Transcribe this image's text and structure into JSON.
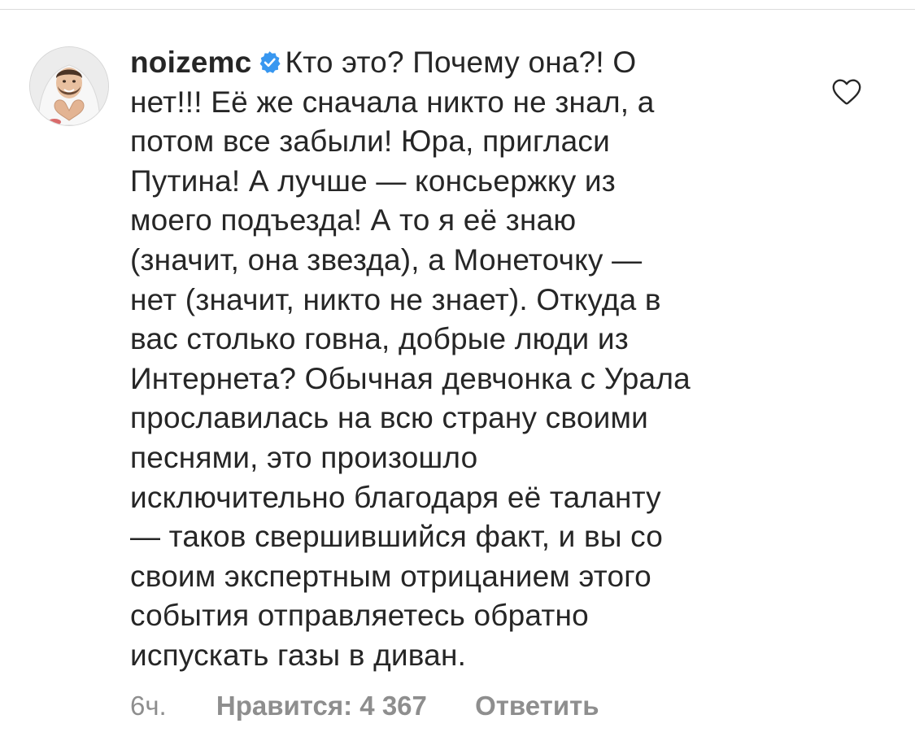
{
  "comment": {
    "username": "noizemc",
    "verified": true,
    "text": "Кто это? Почему она?! О\nнет!!! Её же сначала никто не знал, а\nпотом все забыли! Юра, пригласи\nПутина! А лучше — консьержку из\nмоего подъезда! А то я её знаю\n(значит, она звезда), а Монеточку —\nнет (значит, никто не знает). Откуда в\nвас столько говна, добрые люди из\nИнтернета? Обычная девчонка с Урала\nпрославилась на всю страну своими\nпеснями, это произошло\nисключительно благодаря её таланту\n— таков свершившийся факт, и вы со\nсвоим экспертным отрицанием этого\nсобытия отправляетесь обратно\nиспускать газы в диван.",
    "time": "6ч.",
    "likes_label": "Нравится: 4 367",
    "reply_label": "Ответить"
  },
  "icons": {
    "verified": "verified-badge-icon",
    "like": "heart-outline-icon"
  },
  "colors": {
    "text": "#262626",
    "secondary": "#8e8e8e",
    "verified": "#3897f0",
    "divider": "#dbdbdb"
  }
}
